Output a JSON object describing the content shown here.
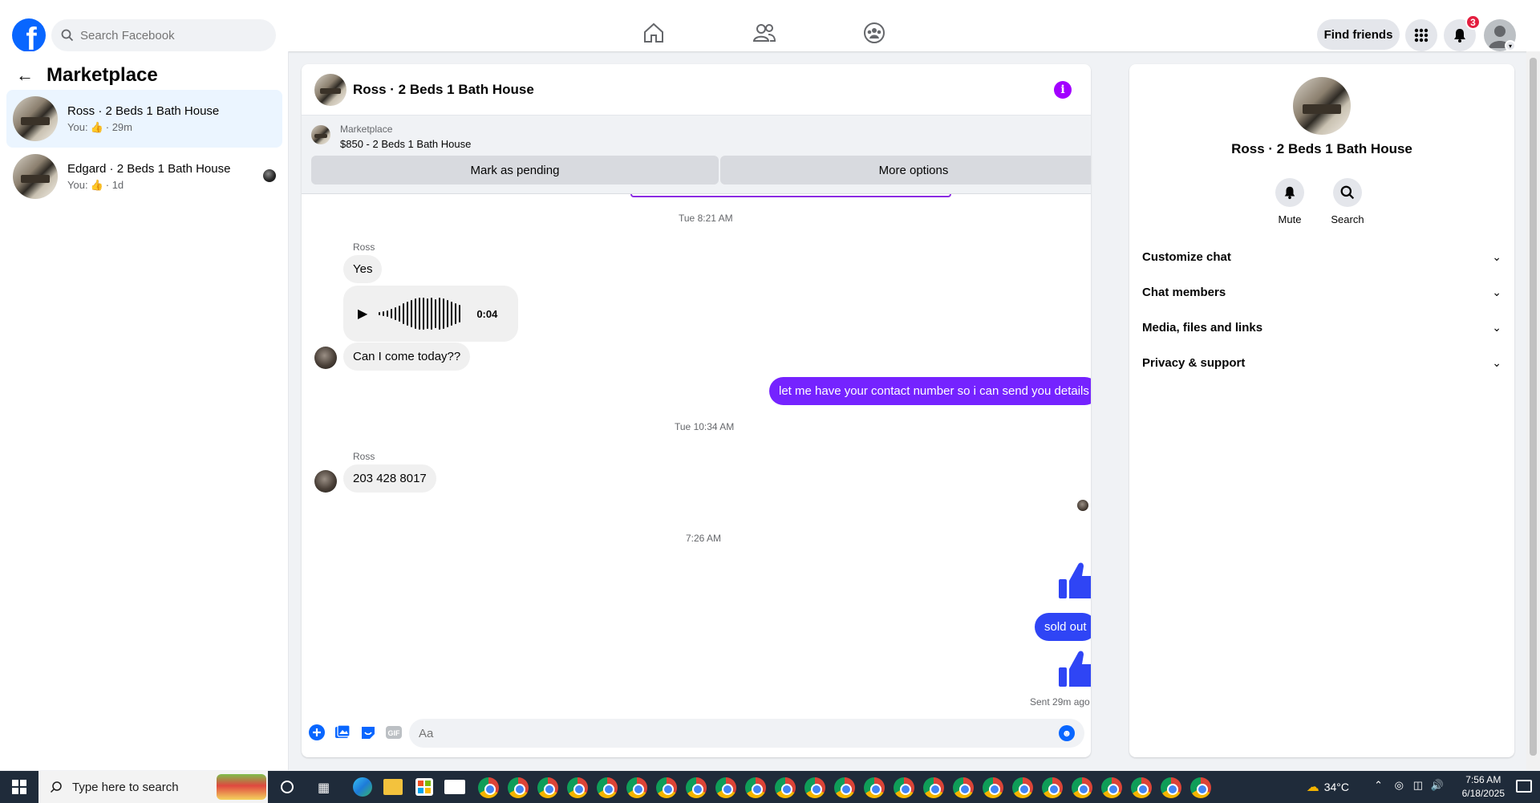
{
  "topnav": {
    "search_placeholder": "Search Facebook",
    "find_friends": "Find friends",
    "notification_count": "3",
    "brand_color": "#0866ff"
  },
  "left": {
    "title": "Marketplace",
    "conversations": [
      {
        "title": "Ross · 2 Beds 1 Bath House",
        "sub_prefix": "You:",
        "sub_suffix": "· 29m",
        "active": true
      },
      {
        "title": "Edgard · 2 Beds 1 Bath House",
        "sub_prefix": "You:",
        "sub_suffix": "· 1d",
        "active": false
      }
    ]
  },
  "chat": {
    "title": "Ross · 2 Beds 1 Bath House",
    "listing": {
      "label": "Marketplace",
      "price_title": "$850 - 2 Beds 1 Bath House",
      "mark_pending": "Mark as pending",
      "more_options": "More options"
    },
    "messages": {
      "ts1": "Tue 8:21 AM",
      "sender1": "Ross",
      "msg_yes": "Yes",
      "audio_duration": "0:04",
      "msg_come": "Can I come today??",
      "msg_contact": "let me have your contact number so i can send you details",
      "ts2": "Tue 10:34 AM",
      "sender2": "Ross",
      "msg_phone": "203 428 8017",
      "ts3": "7:26 AM",
      "msg_sold": "sold out",
      "sent_label": "Sent 29m ago"
    },
    "composer_placeholder": "Aa",
    "outgoing_purple": "#7523ff",
    "outgoing_blue": "#2f45f5"
  },
  "right": {
    "name": "Ross · 2 Beds 1 Bath House",
    "actions": [
      {
        "label": "Mute",
        "icon": "bell-icon"
      },
      {
        "label": "Search",
        "icon": "search-icon"
      }
    ],
    "sections": [
      {
        "label": "Customize chat"
      },
      {
        "label": "Chat members"
      },
      {
        "label": "Media, files and links"
      },
      {
        "label": "Privacy & support"
      }
    ]
  },
  "taskbar": {
    "search_text": "Type here to search",
    "temperature": "34°C",
    "time": "7:56 AM",
    "date": "6/18/2025"
  }
}
